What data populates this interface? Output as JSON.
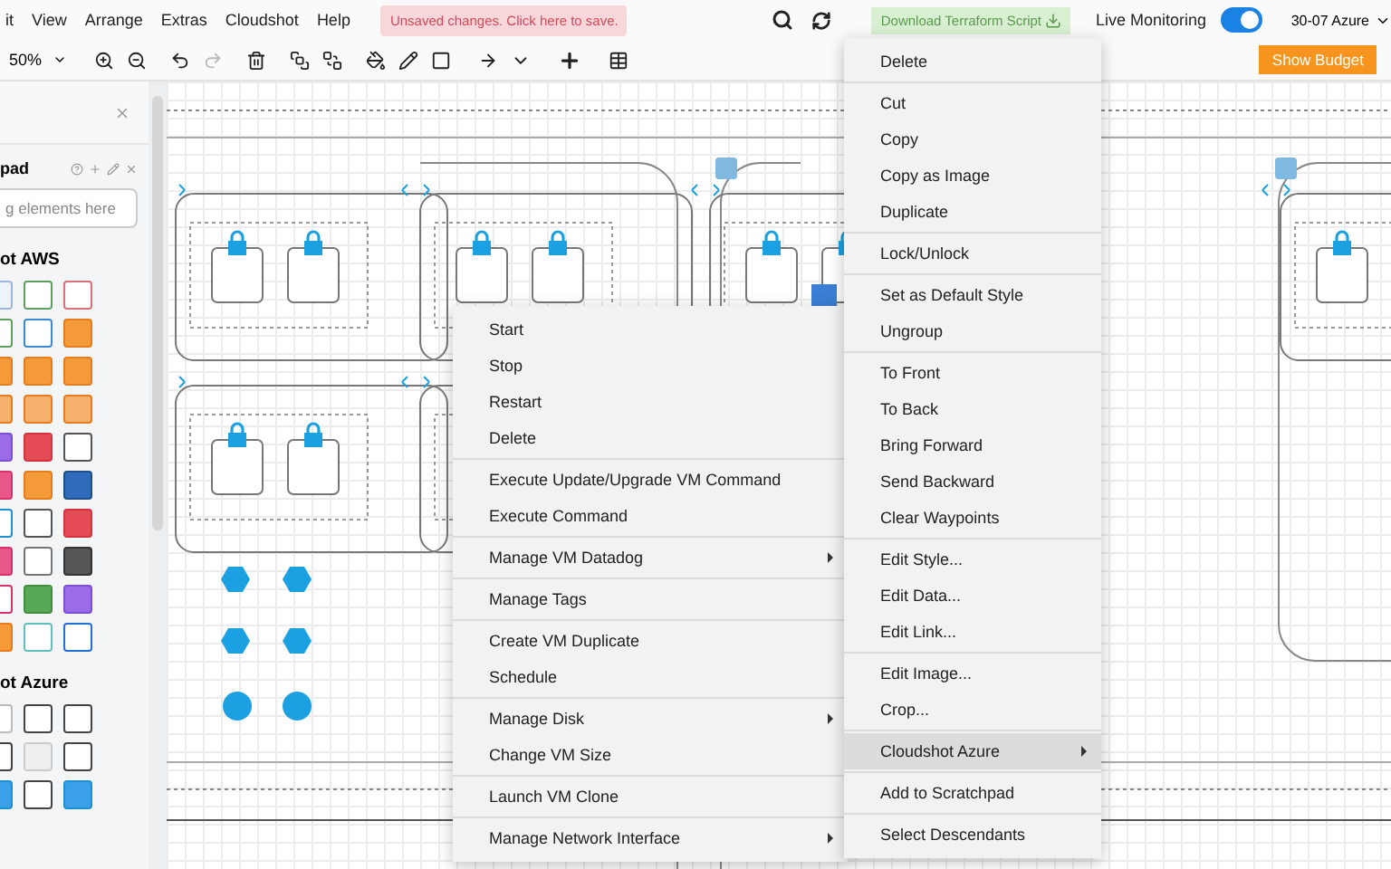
{
  "menubar": {
    "items": [
      "it",
      "View",
      "Arrange",
      "Extras",
      "Cloudshot",
      "Help"
    ],
    "unsaved_notice": "Unsaved changes. Click here to save.",
    "download_button": "Download Terraform Script",
    "live_monitoring": {
      "label": "Live Monitoring",
      "on": true
    },
    "workspace": "30-07 Azure"
  },
  "toolbar": {
    "zoom": "50%",
    "show_budget": "Show Budget"
  },
  "sidebar": {
    "scratchpad_title": "pad",
    "search": {
      "placeholder": "g elements here"
    },
    "sections": [
      {
        "title": "ot AWS"
      },
      {
        "title": "ot Azure"
      }
    ]
  },
  "vm_menu": {
    "groups": [
      [
        {
          "label": "Start",
          "submenu": false
        },
        {
          "label": "Stop",
          "submenu": false
        },
        {
          "label": "Restart",
          "submenu": false
        },
        {
          "label": "Delete",
          "submenu": false
        }
      ],
      [
        {
          "label": "Execute Update/Upgrade VM Command",
          "submenu": false
        },
        {
          "label": "Execute Command",
          "submenu": false
        }
      ],
      [
        {
          "label": "Manage VM Datadog",
          "submenu": true
        }
      ],
      [
        {
          "label": "Manage Tags",
          "submenu": false
        }
      ],
      [
        {
          "label": "Create VM Duplicate",
          "submenu": false
        },
        {
          "label": "Schedule",
          "submenu": false
        }
      ],
      [
        {
          "label": "Manage Disk",
          "submenu": true
        },
        {
          "label": "Change VM Size",
          "submenu": false
        }
      ],
      [
        {
          "label": "Launch VM Clone",
          "submenu": false
        }
      ],
      [
        {
          "label": "Manage Network Interface",
          "submenu": true
        }
      ]
    ]
  },
  "context_menu": {
    "groups": [
      [
        {
          "label": "Delete",
          "submenu": false,
          "selected": false
        }
      ],
      [
        {
          "label": "Cut",
          "submenu": false,
          "selected": false
        },
        {
          "label": "Copy",
          "submenu": false,
          "selected": false
        },
        {
          "label": "Copy as Image",
          "submenu": false,
          "selected": false
        },
        {
          "label": "Duplicate",
          "submenu": false,
          "selected": false
        }
      ],
      [
        {
          "label": "Lock/Unlock",
          "submenu": false,
          "selected": false
        }
      ],
      [
        {
          "label": "Set as Default Style",
          "submenu": false,
          "selected": false
        },
        {
          "label": "Ungroup",
          "submenu": false,
          "selected": false
        }
      ],
      [
        {
          "label": "To Front",
          "submenu": false,
          "selected": false
        },
        {
          "label": "To Back",
          "submenu": false,
          "selected": false
        },
        {
          "label": "Bring Forward",
          "submenu": false,
          "selected": false
        },
        {
          "label": "Send Backward",
          "submenu": false,
          "selected": false
        },
        {
          "label": "Clear Waypoints",
          "submenu": false,
          "selected": false
        }
      ],
      [
        {
          "label": "Edit Style...",
          "submenu": false,
          "selected": false
        },
        {
          "label": "Edit Data...",
          "submenu": false,
          "selected": false
        },
        {
          "label": "Edit Link...",
          "submenu": false,
          "selected": false
        }
      ],
      [
        {
          "label": "Edit Image...",
          "submenu": false,
          "selected": false
        },
        {
          "label": "Crop...",
          "submenu": false,
          "selected": false
        }
      ],
      [
        {
          "label": "Cloudshot Azure",
          "submenu": true,
          "selected": true
        }
      ],
      [
        {
          "label": "Add to Scratchpad",
          "submenu": false,
          "selected": false
        }
      ],
      [
        {
          "label": "Select Descendants",
          "submenu": false,
          "selected": false
        }
      ]
    ]
  }
}
